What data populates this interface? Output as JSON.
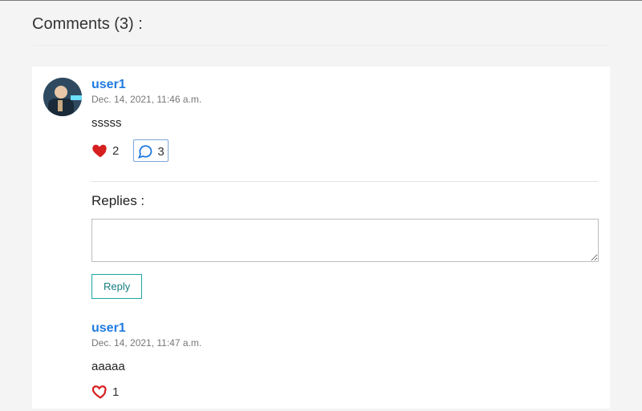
{
  "comments_header": "Comments (3) :",
  "comments": [
    {
      "username": "user1",
      "timestamp": "Dec. 14, 2021, 11:46 a.m.",
      "body": "sssss",
      "likes": "2",
      "reply_count": "3",
      "liked": true
    }
  ],
  "replies_label": "Replies :",
  "reply_button_label": "Reply",
  "replies": [
    {
      "username": "user1",
      "timestamp": "Dec. 14, 2021, 11:47 a.m.",
      "body": "aaaaa",
      "likes": "1",
      "liked": false
    }
  ]
}
